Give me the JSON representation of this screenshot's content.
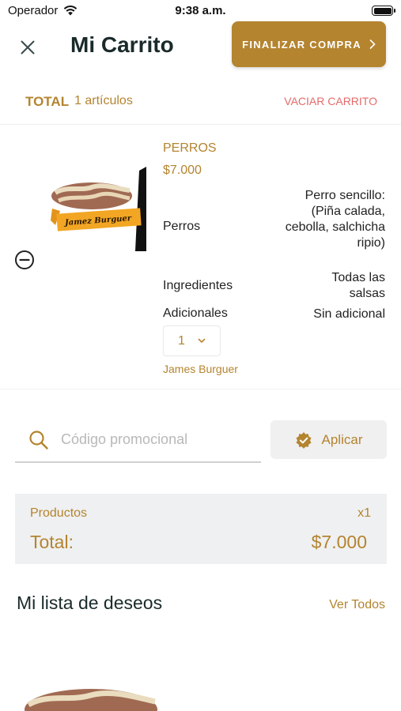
{
  "status_bar": {
    "carrier": "Operador",
    "time": "9:38 a.m."
  },
  "header": {
    "title": "Mi Carrito",
    "checkout_label": "FINALIZAR COMPRA"
  },
  "summary": {
    "total_label": "TOTAL",
    "item_count": "1 artículos",
    "clear_label": "VACIAR CARRITO"
  },
  "cart_item": {
    "category": "PERROS",
    "price": "$7.000",
    "image_brand_text": "Jamez Burguer",
    "options": [
      {
        "label": "Perros",
        "value": "Perro sencillo: (Piña calada, cebolla, salchicha ripio)"
      },
      {
        "label": "Ingredientes",
        "value": "Todas las salsas"
      },
      {
        "label": "Adicionales",
        "value": "Sin adicional"
      }
    ],
    "quantity": "1",
    "restaurant": "James Burguer"
  },
  "promo": {
    "placeholder": "Código promocional",
    "apply_label": "Aplicar"
  },
  "totals": {
    "products_label": "Productos",
    "products_qty": "x1",
    "total_label": "Total:",
    "total_value": "$7.000"
  },
  "wishlist": {
    "title": "Mi lista de deseos",
    "view_all_label": "Ver Todos"
  },
  "colors": {
    "accent": "#b4842f",
    "danger": "#e56a6a",
    "panel": "#eff0f1",
    "title": "#1a2a2a"
  }
}
